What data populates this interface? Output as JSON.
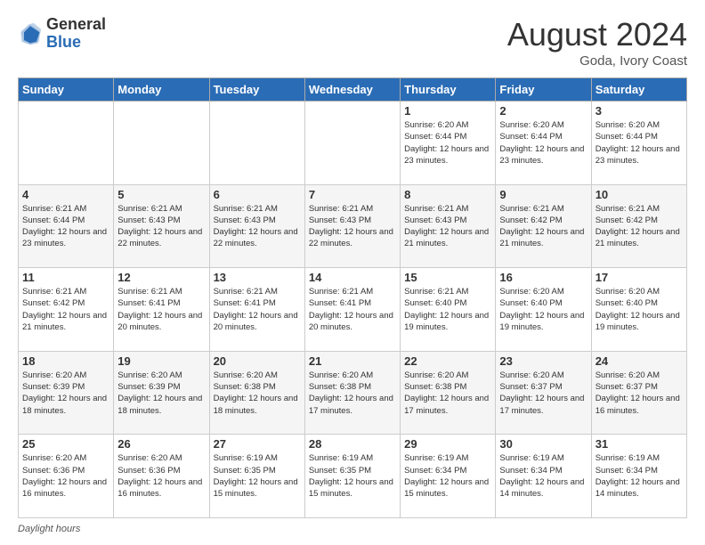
{
  "header": {
    "logo_general": "General",
    "logo_blue": "Blue",
    "month_title": "August 2024",
    "location": "Goda, Ivory Coast"
  },
  "footer": {
    "daylight_label": "Daylight hours"
  },
  "days_of_week": [
    "Sunday",
    "Monday",
    "Tuesday",
    "Wednesday",
    "Thursday",
    "Friday",
    "Saturday"
  ],
  "weeks": [
    [
      {
        "day": "",
        "info": ""
      },
      {
        "day": "",
        "info": ""
      },
      {
        "day": "",
        "info": ""
      },
      {
        "day": "",
        "info": ""
      },
      {
        "day": "1",
        "info": "Sunrise: 6:20 AM\nSunset: 6:44 PM\nDaylight: 12 hours\nand 23 minutes."
      },
      {
        "day": "2",
        "info": "Sunrise: 6:20 AM\nSunset: 6:44 PM\nDaylight: 12 hours\nand 23 minutes."
      },
      {
        "day": "3",
        "info": "Sunrise: 6:20 AM\nSunset: 6:44 PM\nDaylight: 12 hours\nand 23 minutes."
      }
    ],
    [
      {
        "day": "4",
        "info": "Sunrise: 6:21 AM\nSunset: 6:44 PM\nDaylight: 12 hours\nand 23 minutes."
      },
      {
        "day": "5",
        "info": "Sunrise: 6:21 AM\nSunset: 6:43 PM\nDaylight: 12 hours\nand 22 minutes."
      },
      {
        "day": "6",
        "info": "Sunrise: 6:21 AM\nSunset: 6:43 PM\nDaylight: 12 hours\nand 22 minutes."
      },
      {
        "day": "7",
        "info": "Sunrise: 6:21 AM\nSunset: 6:43 PM\nDaylight: 12 hours\nand 22 minutes."
      },
      {
        "day": "8",
        "info": "Sunrise: 6:21 AM\nSunset: 6:43 PM\nDaylight: 12 hours\nand 21 minutes."
      },
      {
        "day": "9",
        "info": "Sunrise: 6:21 AM\nSunset: 6:42 PM\nDaylight: 12 hours\nand 21 minutes."
      },
      {
        "day": "10",
        "info": "Sunrise: 6:21 AM\nSunset: 6:42 PM\nDaylight: 12 hours\nand 21 minutes."
      }
    ],
    [
      {
        "day": "11",
        "info": "Sunrise: 6:21 AM\nSunset: 6:42 PM\nDaylight: 12 hours\nand 21 minutes."
      },
      {
        "day": "12",
        "info": "Sunrise: 6:21 AM\nSunset: 6:41 PM\nDaylight: 12 hours\nand 20 minutes."
      },
      {
        "day": "13",
        "info": "Sunrise: 6:21 AM\nSunset: 6:41 PM\nDaylight: 12 hours\nand 20 minutes."
      },
      {
        "day": "14",
        "info": "Sunrise: 6:21 AM\nSunset: 6:41 PM\nDaylight: 12 hours\nand 20 minutes."
      },
      {
        "day": "15",
        "info": "Sunrise: 6:21 AM\nSunset: 6:40 PM\nDaylight: 12 hours\nand 19 minutes."
      },
      {
        "day": "16",
        "info": "Sunrise: 6:20 AM\nSunset: 6:40 PM\nDaylight: 12 hours\nand 19 minutes."
      },
      {
        "day": "17",
        "info": "Sunrise: 6:20 AM\nSunset: 6:40 PM\nDaylight: 12 hours\nand 19 minutes."
      }
    ],
    [
      {
        "day": "18",
        "info": "Sunrise: 6:20 AM\nSunset: 6:39 PM\nDaylight: 12 hours\nand 18 minutes."
      },
      {
        "day": "19",
        "info": "Sunrise: 6:20 AM\nSunset: 6:39 PM\nDaylight: 12 hours\nand 18 minutes."
      },
      {
        "day": "20",
        "info": "Sunrise: 6:20 AM\nSunset: 6:38 PM\nDaylight: 12 hours\nand 18 minutes."
      },
      {
        "day": "21",
        "info": "Sunrise: 6:20 AM\nSunset: 6:38 PM\nDaylight: 12 hours\nand 17 minutes."
      },
      {
        "day": "22",
        "info": "Sunrise: 6:20 AM\nSunset: 6:38 PM\nDaylight: 12 hours\nand 17 minutes."
      },
      {
        "day": "23",
        "info": "Sunrise: 6:20 AM\nSunset: 6:37 PM\nDaylight: 12 hours\nand 17 minutes."
      },
      {
        "day": "24",
        "info": "Sunrise: 6:20 AM\nSunset: 6:37 PM\nDaylight: 12 hours\nand 16 minutes."
      }
    ],
    [
      {
        "day": "25",
        "info": "Sunrise: 6:20 AM\nSunset: 6:36 PM\nDaylight: 12 hours\nand 16 minutes."
      },
      {
        "day": "26",
        "info": "Sunrise: 6:20 AM\nSunset: 6:36 PM\nDaylight: 12 hours\nand 16 minutes."
      },
      {
        "day": "27",
        "info": "Sunrise: 6:19 AM\nSunset: 6:35 PM\nDaylight: 12 hours\nand 15 minutes."
      },
      {
        "day": "28",
        "info": "Sunrise: 6:19 AM\nSunset: 6:35 PM\nDaylight: 12 hours\nand 15 minutes."
      },
      {
        "day": "29",
        "info": "Sunrise: 6:19 AM\nSunset: 6:34 PM\nDaylight: 12 hours\nand 15 minutes."
      },
      {
        "day": "30",
        "info": "Sunrise: 6:19 AM\nSunset: 6:34 PM\nDaylight: 12 hours\nand 14 minutes."
      },
      {
        "day": "31",
        "info": "Sunrise: 6:19 AM\nSunset: 6:34 PM\nDaylight: 12 hours\nand 14 minutes."
      }
    ]
  ]
}
